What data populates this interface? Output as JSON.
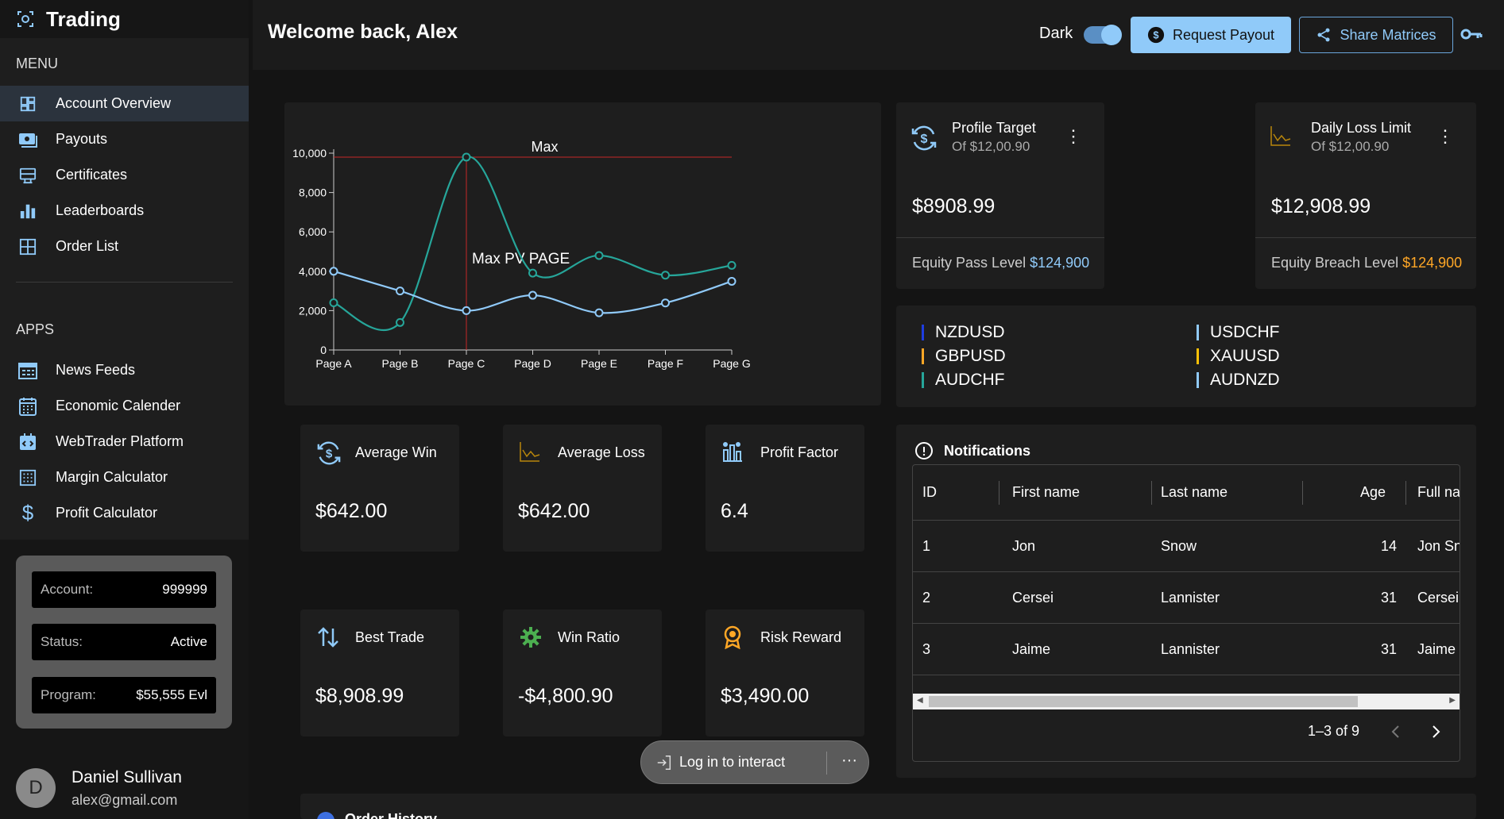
{
  "app": {
    "title": "Trading"
  },
  "sidebar": {
    "menu_label": "MENU",
    "menu_items": [
      {
        "label": "Account Overview",
        "icon": "dashboard-icon",
        "active": true
      },
      {
        "label": "Payouts",
        "icon": "payouts-icon"
      },
      {
        "label": "Certificates",
        "icon": "certificate-icon"
      },
      {
        "label": "Leaderboards",
        "icon": "leaderboard-icon"
      },
      {
        "label": "Order List",
        "icon": "grid-icon"
      }
    ],
    "apps_label": "APPS",
    "app_items": [
      {
        "label": "News Feeds",
        "icon": "news-icon"
      },
      {
        "label": "Economic Calender",
        "icon": "calendar-icon"
      },
      {
        "label": "WebTrader Platform",
        "icon": "webtrader-icon"
      },
      {
        "label": "Margin Calculator",
        "icon": "calculator-icon"
      },
      {
        "label": "Profit Calculator",
        "icon": "dollar-icon"
      }
    ],
    "account": {
      "account_label": "Account:",
      "account_value": "999999",
      "status_label": "Status:",
      "status_value": "Active",
      "program_label": "Program:",
      "program_value": "$55,555 Evl"
    },
    "user": {
      "initial": "D",
      "name": "Daniel Sullivan",
      "email": "alex@gmail.com"
    }
  },
  "header": {
    "welcome": "Welcome back, Alex",
    "dark_label": "Dark",
    "dark_mode": true,
    "payout_label": "Request Payout",
    "share_label": "Share Matrices"
  },
  "chart_data": {
    "type": "line",
    "categories": [
      "Page A",
      "Page B",
      "Page C",
      "Page D",
      "Page E",
      "Page F",
      "Page G"
    ],
    "series": [
      {
        "color": "#26a69a",
        "values": [
          2400,
          1398,
          9800,
          3908,
          4800,
          3800,
          4300
        ]
      },
      {
        "color": "#90caf9",
        "values": [
          4000,
          3000,
          2000,
          2780,
          1890,
          2390,
          3490
        ]
      }
    ],
    "ylim": [
      0,
      10000
    ],
    "yticks": [
      "0",
      "2,000",
      "4,000",
      "6,000",
      "8,000",
      "10,000"
    ],
    "reference_line_y": {
      "value": 9800,
      "label": "Max"
    },
    "reference_line_x": {
      "value": "Page C",
      "label": "Max PV PAGE"
    },
    "grid": false
  },
  "profit_target": {
    "title": "Profile Target",
    "sub": "Of $12,00.90",
    "amount": "$8908.99",
    "foot_label": "Equity Pass Level",
    "foot_value": "$124,900"
  },
  "daily_loss": {
    "title": "Daily Loss Limit",
    "sub": "Of $12,00.90",
    "amount": "$12,908.99",
    "foot_label": "Equity Breach Level",
    "foot_value": "$124,900"
  },
  "pairs": [
    {
      "name": "NZDUSD",
      "color": "#1e3de0"
    },
    {
      "name": "USDCHF",
      "color": "#90caf9"
    },
    {
      "name": "GBPUSD",
      "color": "#ffa726"
    },
    {
      "name": "XAUUSD",
      "color": "#ffc107"
    },
    {
      "name": "AUDCHF",
      "color": "#26a69a"
    },
    {
      "name": "AUDNZD",
      "color": "#90caf9"
    }
  ],
  "stats": [
    {
      "title": "Average Win",
      "value": "$642.00",
      "icon": "money-cycle-icon"
    },
    {
      "title": "Average Loss",
      "value": "$642.00",
      "icon": "loss-chart-icon"
    },
    {
      "title": "Profit Factor",
      "value": "6.4",
      "icon": "factor-icon"
    },
    {
      "title": "Best Trade",
      "value": "$8,908.99",
      "icon": "swap-vertical-icon"
    },
    {
      "title": "Win Ratio",
      "value": "-$4,800.90",
      "icon": "gear-icon"
    },
    {
      "title": "Risk Reward",
      "value": "$3,490.00",
      "icon": "award-icon"
    }
  ],
  "notifications": {
    "title": "Notifications",
    "columns": [
      "ID",
      "First name",
      "Last name",
      "Age",
      "Full na"
    ],
    "rows": [
      [
        "1",
        "Jon",
        "Snow",
        "14",
        "Jon Sn"
      ],
      [
        "2",
        "Cersei",
        "Lannister",
        "31",
        "Cersei"
      ],
      [
        "3",
        "Jaime",
        "Lannister",
        "31",
        "Jaime"
      ]
    ],
    "pagination": "1–3 of 9"
  },
  "login_pill": {
    "label": "Log in to interact",
    "more": "···"
  },
  "order_history": {
    "title": "Order History"
  }
}
